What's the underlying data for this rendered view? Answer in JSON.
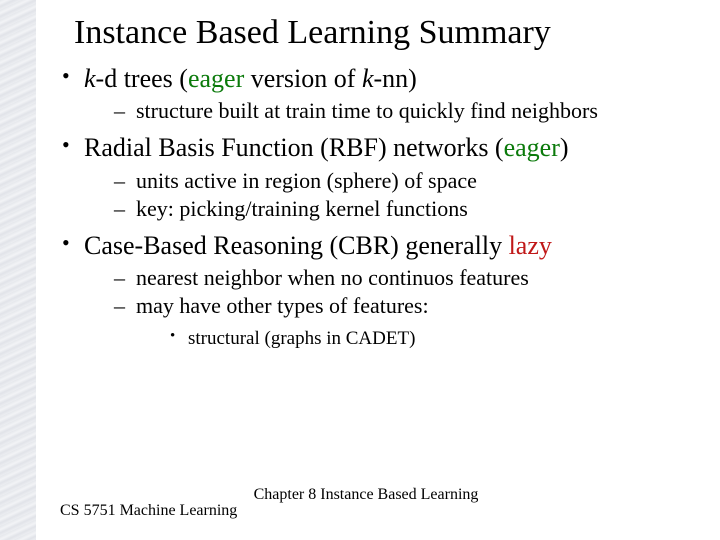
{
  "title": "Instance Based Learning Summary",
  "bullets": {
    "b1_pre": "k",
    "b1_mid": "-d trees (",
    "b1_eager": "eager",
    "b1_post1": " version of ",
    "b1_k": "k",
    "b1_post2": "-nn)",
    "b1_sub1": "structure built at train time to quickly find neighbors",
    "b2_pre": "Radial Basis Function (RBF) networks (",
    "b2_eager": "eager",
    "b2_post": ")",
    "b2_sub1": "units active in region (sphere) of space",
    "b2_sub2": "key: picking/training kernel functions",
    "b3_pre": "Case-Based Reasoning (CBR) generally ",
    "b3_lazy": "lazy",
    "b3_sub1": "nearest neighbor when no continuos features",
    "b3_sub2": "may have other types of features:",
    "b3_subsub1": "structural (graphs in CADET)"
  },
  "footer": {
    "left": "CS 5751 Machine Learning",
    "center": "Chapter 8  Instance Based Learning"
  }
}
